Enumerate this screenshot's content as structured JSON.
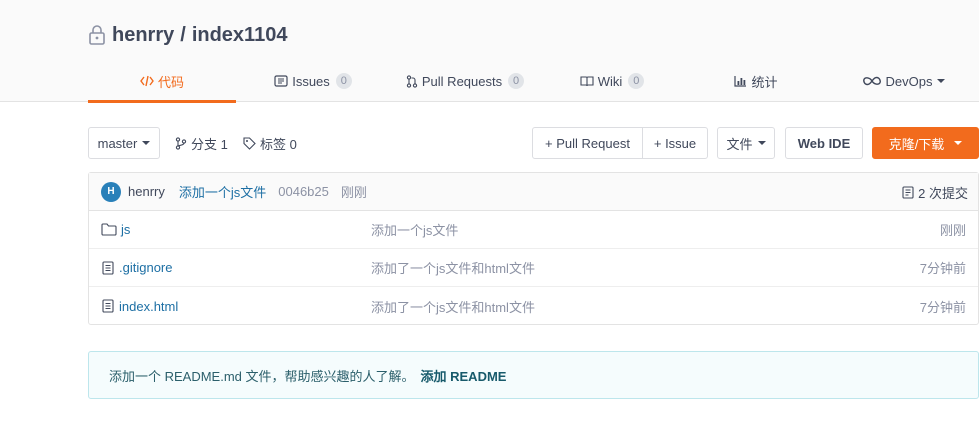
{
  "repo": {
    "owner": "henrry",
    "separator": "/",
    "name": "index1104"
  },
  "tabs": [
    {
      "label": "代码",
      "icon": "code-icon",
      "count": null,
      "active": true
    },
    {
      "label": "Issues",
      "icon": "issues-icon",
      "count": "0"
    },
    {
      "label": "Pull Requests",
      "icon": "pull-request-icon",
      "count": "0"
    },
    {
      "label": "Wiki",
      "icon": "wiki-icon",
      "count": "0"
    },
    {
      "label": "统计",
      "icon": "stats-icon",
      "count": null
    },
    {
      "label": "DevOps",
      "icon": "devops-infinity-icon",
      "count": null
    }
  ],
  "toolbar": {
    "branch": "master",
    "branches_label": "分支 1",
    "tags_label": "标签 0",
    "pull_request_label": "+ Pull Request",
    "issue_label": "+ Issue",
    "file_label": "文件",
    "webide_label": "Web IDE",
    "clone_label": "克隆/下载"
  },
  "commit": {
    "avatar_letter": "H",
    "author": "henrry",
    "message": "添加一个js文件",
    "sha": "0046b25",
    "time": "刚刚",
    "count_label": "2 次提交"
  },
  "files": [
    {
      "name": "js",
      "type": "folder",
      "commit": "添加一个js文件",
      "time": "刚刚"
    },
    {
      "name": ".gitignore",
      "type": "file",
      "commit": "添加了一个js文件和html文件",
      "time": "7分钟前"
    },
    {
      "name": "index.html",
      "type": "file",
      "commit": "添加了一个js文件和html文件",
      "time": "7分钟前"
    }
  ],
  "readme": {
    "text": "添加一个 README.md 文件，帮助感兴趣的人了解。",
    "link": "添加 README"
  },
  "colors": {
    "accent": "#f26b1d",
    "link": "#1d6fa4",
    "avatar": "#2980b9"
  }
}
